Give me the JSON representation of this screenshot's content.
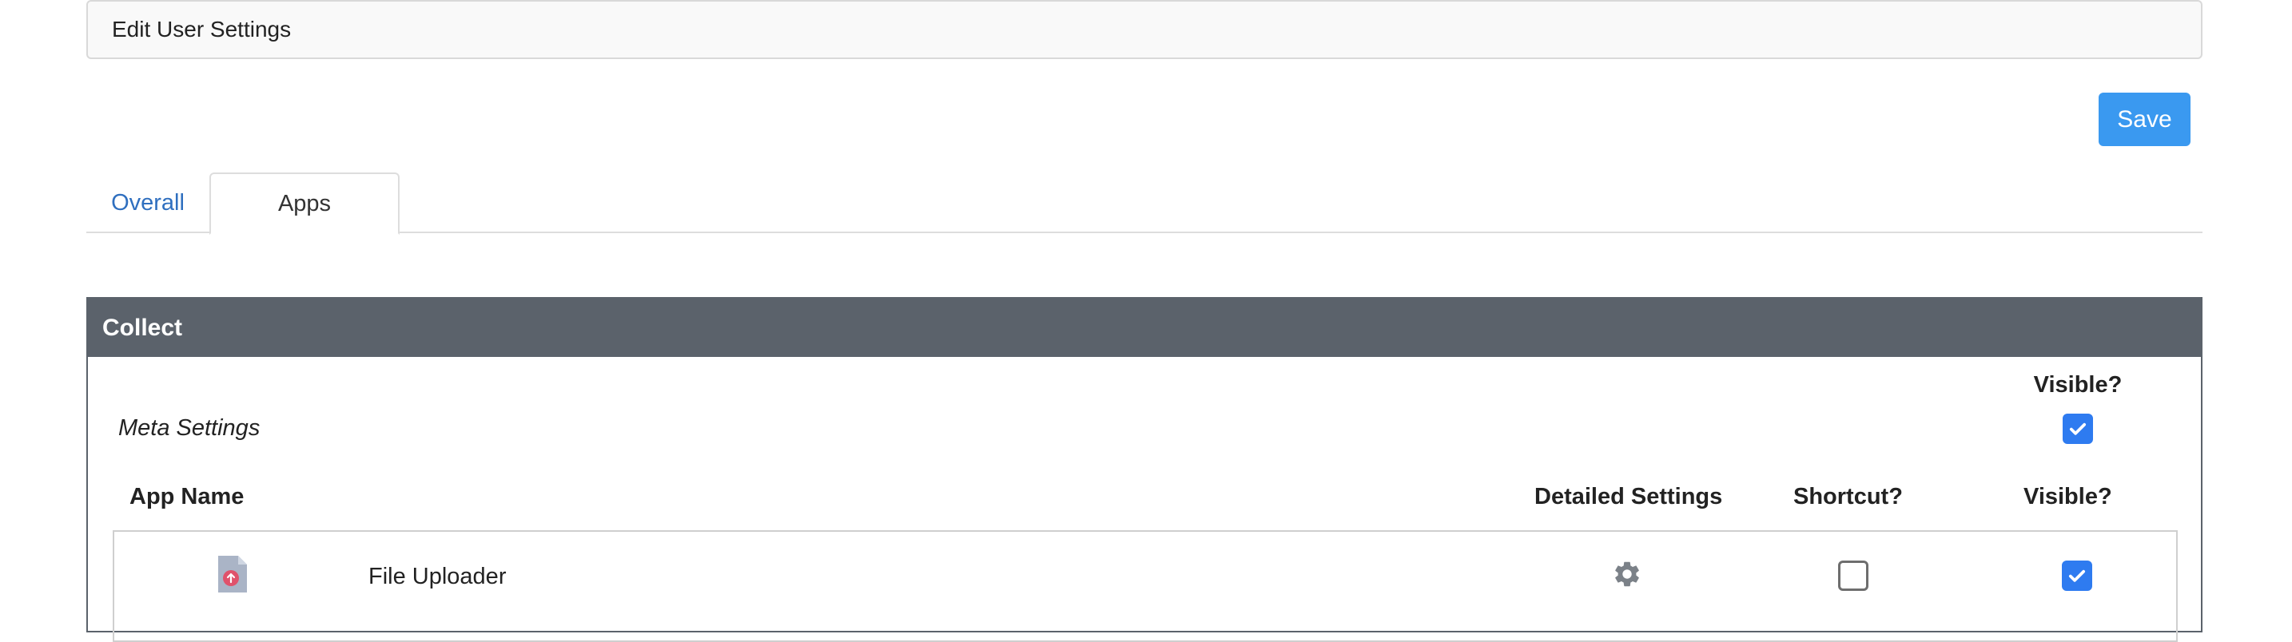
{
  "header": {
    "title": "Edit User Settings"
  },
  "toolbar": {
    "save_label": "Save"
  },
  "tabs": [
    {
      "label": "Overall",
      "active": false
    },
    {
      "label": "Apps",
      "active": true
    }
  ],
  "collect": {
    "title": "Collect",
    "meta": {
      "label": "Meta Settings",
      "visible_header": "Visible?",
      "visible": true
    },
    "columns": {
      "app_name": "App Name",
      "detailed_settings": "Detailed Settings",
      "shortcut": "Shortcut?",
      "visible": "Visible?"
    },
    "apps": [
      {
        "name": "File Uploader",
        "icon": "file-upload-icon",
        "settings_icon": "gear-icon",
        "shortcut": false,
        "visible": true
      }
    ]
  },
  "colors": {
    "accent": "#3a99f0",
    "checkbox": "#2e7bf0",
    "panel_header": "#5b626b",
    "link": "#2f6fbf",
    "file_icon": "#e0526b"
  }
}
